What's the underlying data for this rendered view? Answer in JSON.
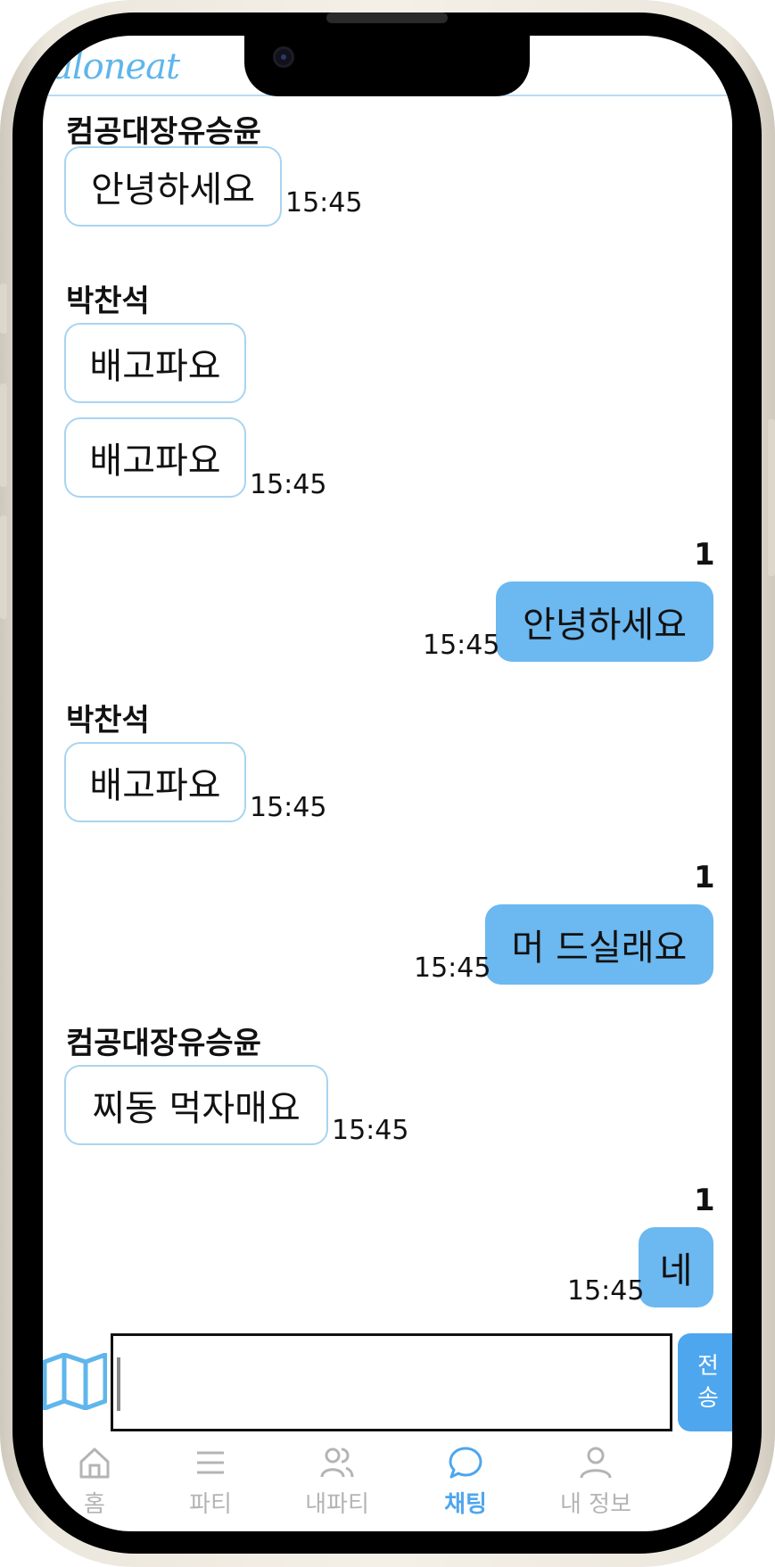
{
  "app": {
    "logo": "aloneat"
  },
  "messages": [
    {
      "sender": "컴공대장유승윤",
      "bubbles": [
        "안녕하세요"
      ],
      "time": "15:45"
    },
    {
      "sender": "박찬석",
      "bubbles": [
        "배고파요",
        "배고파요"
      ],
      "time": "15:45"
    },
    {
      "mine": true,
      "unread": "1",
      "bubbles": [
        "안녕하세요"
      ],
      "time": "15:45"
    },
    {
      "sender": "박찬석",
      "bubbles": [
        "배고파요"
      ],
      "time": "15:45"
    },
    {
      "mine": true,
      "unread": "1",
      "bubbles": [
        "머 드실래요"
      ],
      "time": "15:45"
    },
    {
      "sender": "컴공대장유승윤",
      "bubbles": [
        "찌동 먹자매요"
      ],
      "time": "15:45"
    },
    {
      "mine": true,
      "unread": "1",
      "bubbles": [
        "네"
      ],
      "time": "15:45"
    }
  ],
  "composer": {
    "value": "",
    "send_label_line1": "전",
    "send_label_line2": "송",
    "map_icon": "map-icon"
  },
  "nav": {
    "items": [
      {
        "label": "홈",
        "icon": "home-icon",
        "active": false
      },
      {
        "label": "파티",
        "icon": "menu-icon",
        "active": false
      },
      {
        "label": "내파티",
        "icon": "users-icon",
        "active": false
      },
      {
        "label": "채팅",
        "icon": "chat-bubble-icon",
        "active": true
      },
      {
        "label": "내 정보",
        "icon": "user-icon",
        "active": false
      }
    ]
  },
  "colors": {
    "accent": "#4ea6ee",
    "bubble_out": "#6cb8f0",
    "bubble_in_border": "#a9d4f0"
  }
}
